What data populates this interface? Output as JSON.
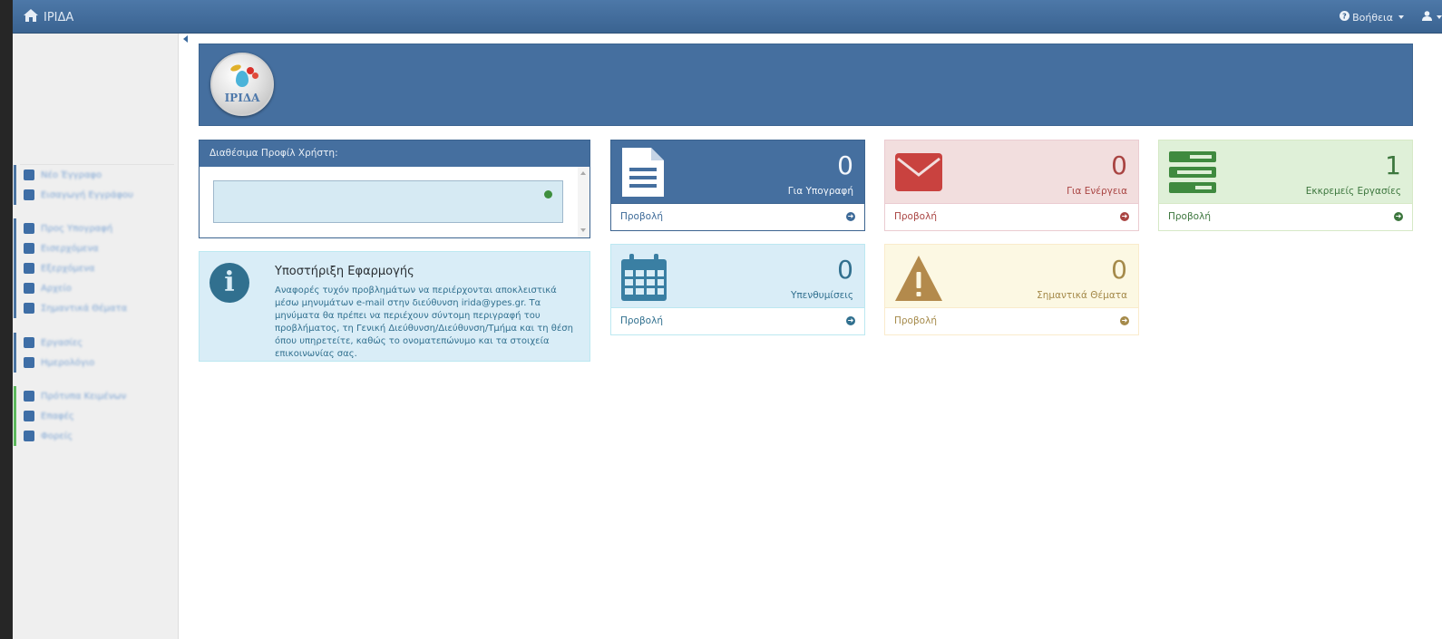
{
  "app": {
    "title": "ΙΡΙΔΑ"
  },
  "topbar": {
    "help_label": "Βοήθεια"
  },
  "banner": {
    "logo_text": "ΙΡΙΔΑ"
  },
  "profile_panel": {
    "title": "Διαθέσιμα Προφίλ Χρήστη:"
  },
  "support": {
    "title": "Υποστήριξη Εφαρμογής",
    "text": "Αναφορές τυχόν προβλημάτων να περιέρχονται αποκλειστικά μέσω μηνυμάτων e-mail στην διεύθυνση irida@ypes.gr. Τα μηνύματα θα πρέπει να περιέχουν σύντομη περιγραφή του προβλήματος, τη Γενική Διεύθυνση/Διεύθυνση/Τμήμα και τη θέση όπου υπηρετείτε, καθώς το ονοματεπώνυμο και τα στοιχεία επικοινωνίας σας."
  },
  "tiles": [
    {
      "count": "0",
      "label": "Για Υπογραφή",
      "link": "Προβολή",
      "icon": "document-icon"
    },
    {
      "count": "0",
      "label": "Για Ενέργεια",
      "link": "Προβολή",
      "icon": "envelope-icon"
    },
    {
      "count": "1",
      "label": "Εκκρεμείς Εργασίες",
      "link": "Προβολή",
      "icon": "tasks-icon"
    },
    {
      "count": "0",
      "label": "Υπενθυμίσεις",
      "link": "Προβολή",
      "icon": "calendar-icon"
    },
    {
      "count": "0",
      "label": "Σημαντικά Θέματα",
      "link": "Προβολή",
      "icon": "warning-icon"
    }
  ],
  "sidebar": {
    "items": [
      {
        "label": "Νέο Έγγραφο",
        "icon": "new-document-icon"
      },
      {
        "label": "Εισαγωγή Εγγράφου",
        "icon": "upload-icon"
      },
      {
        "label": "Προς Υπογραφή",
        "icon": "pencil-icon"
      },
      {
        "label": "Εισερχόμενα",
        "icon": "inbox-icon"
      },
      {
        "label": "Εξερχόμενα",
        "icon": "send-icon"
      },
      {
        "label": "Αρχείο",
        "icon": "archive-icon"
      },
      {
        "label": "Σημαντικά Θέματα",
        "icon": "warning-icon"
      },
      {
        "label": "Εργασίες",
        "icon": "tasks-icon"
      },
      {
        "label": "Ημερολόγιο",
        "icon": "calendar-icon"
      },
      {
        "label": "Πρότυπα Κειμένων",
        "icon": "book-icon"
      },
      {
        "label": "Επαφές",
        "icon": "contacts-icon"
      },
      {
        "label": "Φορείς",
        "icon": "institution-icon"
      }
    ]
  },
  "colors": {
    "primary": "#456f9f",
    "danger": "#a94442",
    "success": "#3c763d",
    "info": "#31708f",
    "warning": "#a58a4a"
  }
}
